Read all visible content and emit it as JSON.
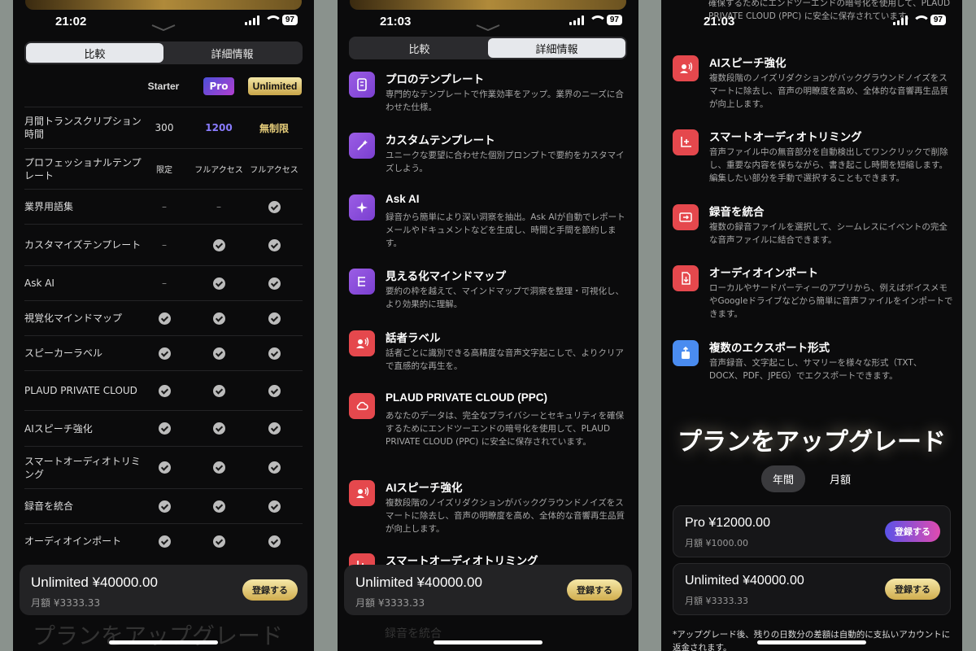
{
  "status": {
    "p1_time": "21:02",
    "p2_time": "21:03",
    "p3_time": "21:03",
    "battery": "97"
  },
  "segment": {
    "compare": "比較",
    "details": "詳細情報"
  },
  "compare": {
    "plans": [
      "Starter",
      "Pro",
      "Unlimited"
    ],
    "rows": [
      {
        "label": "月間トランスクリプション時間",
        "starter": "300",
        "pro": "1200",
        "unlimited": "無制限"
      },
      {
        "label": "プロフェッショナルテンプレート",
        "starter": "限定",
        "pro": "フルアクセス",
        "unlimited": "フルアクセス"
      },
      {
        "label": "業界用語集",
        "starter": "–",
        "pro": "–",
        "unlimited": "check"
      },
      {
        "label": "カスタマイズテンプレート",
        "starter": "–",
        "pro": "check",
        "unlimited": "check"
      },
      {
        "label": "Ask AI",
        "starter": "–",
        "pro": "check",
        "unlimited": "check"
      },
      {
        "label": "視覚化マインドマップ",
        "starter": "check",
        "pro": "check",
        "unlimited": "check"
      },
      {
        "label": "スピーカーラベル",
        "starter": "check",
        "pro": "check",
        "unlimited": "check"
      },
      {
        "label": "PLAUD PRIVATE CLOUD",
        "starter": "check",
        "pro": "check",
        "unlimited": "check"
      },
      {
        "label": "AIスピーチ強化",
        "starter": "check",
        "pro": "check",
        "unlimited": "check"
      },
      {
        "label": "スマートオーディオトリミング",
        "starter": "check",
        "pro": "check",
        "unlimited": "check"
      },
      {
        "label": "録音を統合",
        "starter": "check",
        "pro": "check",
        "unlimited": "check"
      },
      {
        "label": "オーディオインポート",
        "starter": "check",
        "pro": "check",
        "unlimited": "check"
      }
    ]
  },
  "bottom_card": {
    "plan": "Unlimited ¥40000.00",
    "sub": "月額 ¥3333.33",
    "button": "登録する"
  },
  "faded": {
    "upgrade": "プランをアップグレード",
    "merge": "録音を統合"
  },
  "features_p2": [
    {
      "title": "プロのテンプレート",
      "desc": "専門的なテンプレートで作業効率をアップ。業界のニーズに合わせた仕様。",
      "icon": "template-icon"
    },
    {
      "title": "カスタムテンプレート",
      "desc": "ユニークな要望に合わせた個別プロンプトで要約をカスタマイズしよう。",
      "icon": "custom-template-icon"
    },
    {
      "title": "Ask AI",
      "desc": "録音から簡単により深い洞察を抽出。Ask AIが自動でレポートメールやドキュメントなどを生成し、時間と手間を節約します。",
      "icon": "sparkle-icon"
    },
    {
      "title": "見える化マインドマップ",
      "desc": "要約の枠を越えて、マインドマップで洞察を整理・可視化し、より効果的に理解。",
      "icon": "mindmap-icon"
    },
    {
      "title": "話者ラベル",
      "desc": "話者ごとに識別できる高精度な音声文字起こしで、よりクリアで直感的な再生を。",
      "icon": "speaker-icon"
    },
    {
      "title": "PLAUD PRIVATE CLOUD (PPC)",
      "desc": "あなたのデータは、完全なプライバシーとセキュリティを確保するためにエンドツーエンドの暗号化を使用して、PLAUD PRIVATE CLOUD (PPC) に安全に保存されています。",
      "icon": "cloud-icon"
    },
    {
      "title": "AIスピーチ強化",
      "desc": "複数段階のノイズリダクションがバックグラウンドノイズをスマートに除去し、音声の明瞭度を高め、全体的な音響再生品質が向上します。",
      "icon": "speech-icon"
    },
    {
      "title": "スマートオーディオトリミング",
      "desc": "",
      "icon": "trim-icon"
    }
  ],
  "p3_top_text": "確保するためにエンドツーエンドの暗号化を使用して、PLAUD PRIVATE CLOUD (PPC) に安全に保存されています。",
  "features_p3": [
    {
      "title": "AIスピーチ強化",
      "desc": "複数段階のノイズリダクションがバックグラウンドノイズをスマートに除去し、音声の明瞭度を高め、全体的な音響再生品質が向上します。",
      "icon": "speech-icon"
    },
    {
      "title": "スマートオーディオトリミング",
      "desc": "音声ファイル中の無音部分を自動検出してワンクリックで削除し、重要な内容を保ちながら、書き起こし時間を短縮します。編集したい部分を手動で選択することもできます。",
      "icon": "trim-icon"
    },
    {
      "title": "録音を統合",
      "desc": "複数の録音ファイルを選択して、シームレスにイベントの完全な音声ファイルに結合できます。",
      "icon": "merge-icon"
    },
    {
      "title": "オーディオインポート",
      "desc": "ローカルやサードパーティーのアプリから、例えばボイスメモやGoogleドライブなどから簡単に音声ファイルをインポートできます。",
      "icon": "import-icon"
    },
    {
      "title": "複数のエクスポート形式",
      "desc": "音声録音、文字起こし、サマリーを様々な形式（TXT、DOCX、PDF、JPEG）でエクスポートできます。",
      "icon": "export-icon"
    }
  ],
  "upgrade": {
    "title": "プランをアップグレード",
    "annual": "年間",
    "monthly": "月額",
    "pro_plan": "Pro ¥12000.00",
    "pro_sub": "月額 ¥1000.00",
    "unl_plan": "Unlimited ¥40000.00",
    "unl_sub": "月額 ¥3333.33",
    "button": "登録する",
    "note": "*アップグレード後、残りの日数分の差額は自動的に支払いアカウントに返金されます。"
  },
  "colors": {
    "background": "#0b0b0c",
    "gold": "#d0ad4e",
    "pro_purple": "#8a7cff",
    "icon_red": "#e5484d",
    "icon_purple": "#9b5de5",
    "icon_blue": "#4a8cf0"
  }
}
